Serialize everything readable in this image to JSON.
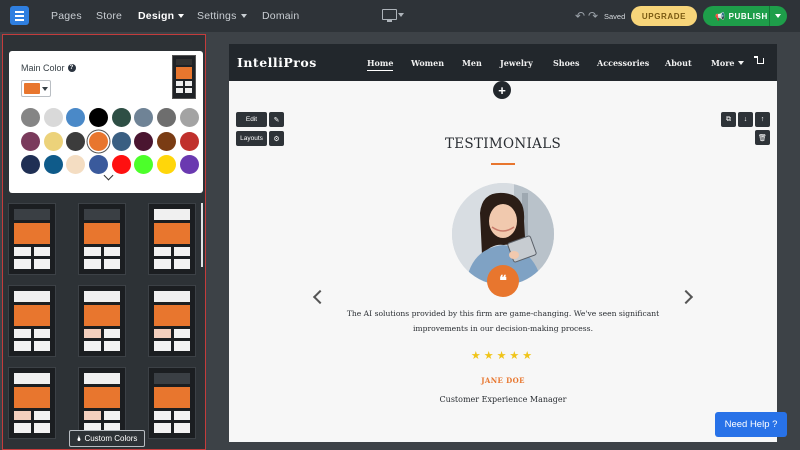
{
  "topbar": {
    "nav": [
      {
        "label": "Pages",
        "has_caret": false
      },
      {
        "label": "Store",
        "has_caret": false
      },
      {
        "label": "Design",
        "has_caret": true,
        "active": true
      },
      {
        "label": "Settings",
        "has_caret": true
      },
      {
        "label": "Domain",
        "has_caret": false
      }
    ],
    "saved_text": "Saved",
    "upgrade_label": "UPGRADE",
    "publish_label": "PUBLISH"
  },
  "color_panel": {
    "main_color_label": "Main Color",
    "help_icon": "?",
    "selected_color": "#e8762e",
    "swatches": [
      "#858585",
      "#d9d9d9",
      "#4a89c8",
      "#000000",
      "#2e4f45",
      "#6f8396",
      "#6e6e6e",
      "#a3a3a3",
      "#7a3b5c",
      "#ecd27a",
      "#3c3c3c",
      "#e8762e",
      "#3a5f82",
      "#4a1530",
      "#7a3c14",
      "#c0302c",
      "#1f2f54",
      "#0f5b8a",
      "#f4ddc2",
      "#3a5a9c",
      "#ff1010",
      "#4cff2a",
      "#ffd60a",
      "#6a39b0"
    ]
  },
  "layout_thumbs": [
    {
      "header": "dark",
      "tint": false
    },
    {
      "header": "dark",
      "tint": false
    },
    {
      "header": "light",
      "tint": false
    },
    {
      "header": "light",
      "tint": false
    },
    {
      "header": "light",
      "tint": true
    },
    {
      "header": "light",
      "tint": true
    },
    {
      "header": "light",
      "tint": true
    },
    {
      "header": "light",
      "tint": true
    },
    {
      "header": "dark",
      "tint": false
    }
  ],
  "custom_colors_label": "Custom Colors",
  "site": {
    "logo": "IntelliPros",
    "nav": [
      "Home",
      "Women",
      "Men",
      "Jewelry",
      "Shoes",
      "Accessories",
      "About",
      "More"
    ],
    "edit_label": "Edit",
    "layouts_label": "Layouts",
    "section_title": "TESTIMONIALS",
    "quote": "The AI solutions provided by this firm are game-changing. We've seen significant improvements in our decision-making process.",
    "stars": "★★★★★",
    "name": "JANE DOE",
    "role": "Customer Experience Manager"
  },
  "help_button_label": "Need Help ?"
}
